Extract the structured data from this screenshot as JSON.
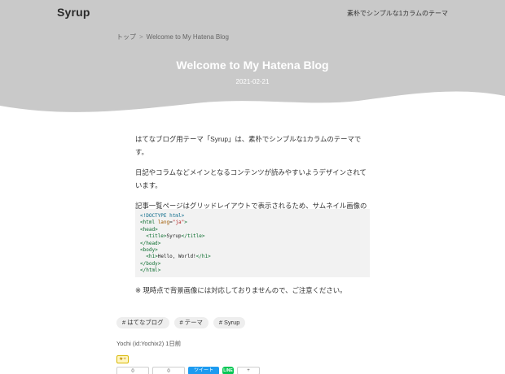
{
  "header": {
    "site_title": "Syrup",
    "site_description": "素朴でシンプルな1カラムのテーマ"
  },
  "breadcrumb": {
    "home": "トップ",
    "separator": ">",
    "current": "Welcome to My Hatena Blog"
  },
  "entry": {
    "title": "Welcome to My Hatena Blog",
    "date": "2021-02-21",
    "paragraphs": [
      "はてなブログ用テーマ「Syrup」は、素朴でシンプルな1カラムのテーマです。",
      "日記やコラムなどメインとなるコンテンツが読みやすいようデザインされています。",
      "記事一覧ページはグリッドレイアウトで表示されるため、サムネイル画像の添付をおすすめします。"
    ],
    "code_lines": [
      "<!DOCTYPE html>",
      "<html lang=\"ja\">",
      "<head>",
      "  <title>Syrup</title>",
      "</head>",
      "<body>",
      "  <h1>Hello, World!</h1>",
      "</body>",
      "</html>"
    ],
    "note": "※ 現時点で背景画像には対応しておりませんので、ご注意ください。"
  },
  "tags": [
    "# はてなブログ",
    "# テーマ",
    "# Syrup"
  ],
  "author": "Yochi (id:Yochix2) 1日前",
  "share": {
    "star_label": "★+",
    "hatena_count": "0",
    "facebook_count": "0",
    "tweet_label": "ツイート",
    "line_label": "LINE",
    "plus_label": "+"
  },
  "colors": {
    "hero_background": "#c9c9c9",
    "page_background": "#ffffff",
    "code_background": "#f2f2f2",
    "tag_background": "#eeeeee"
  }
}
